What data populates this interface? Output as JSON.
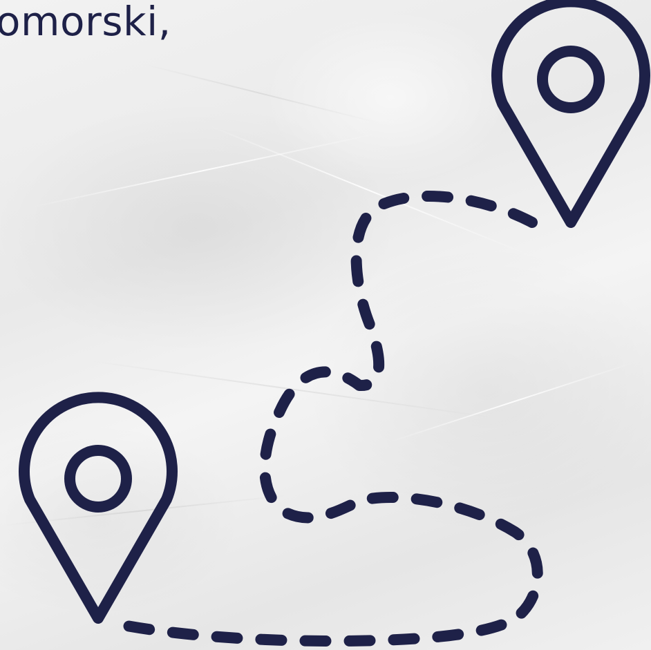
{
  "headline": {
    "text": "omorski,"
  },
  "colors": {
    "ink": "#1e2148",
    "paper": "#eeeeee"
  },
  "icons": {
    "start_pin": "location-pin-icon",
    "end_pin": "location-pin-icon",
    "route": "dashed-route-path"
  }
}
